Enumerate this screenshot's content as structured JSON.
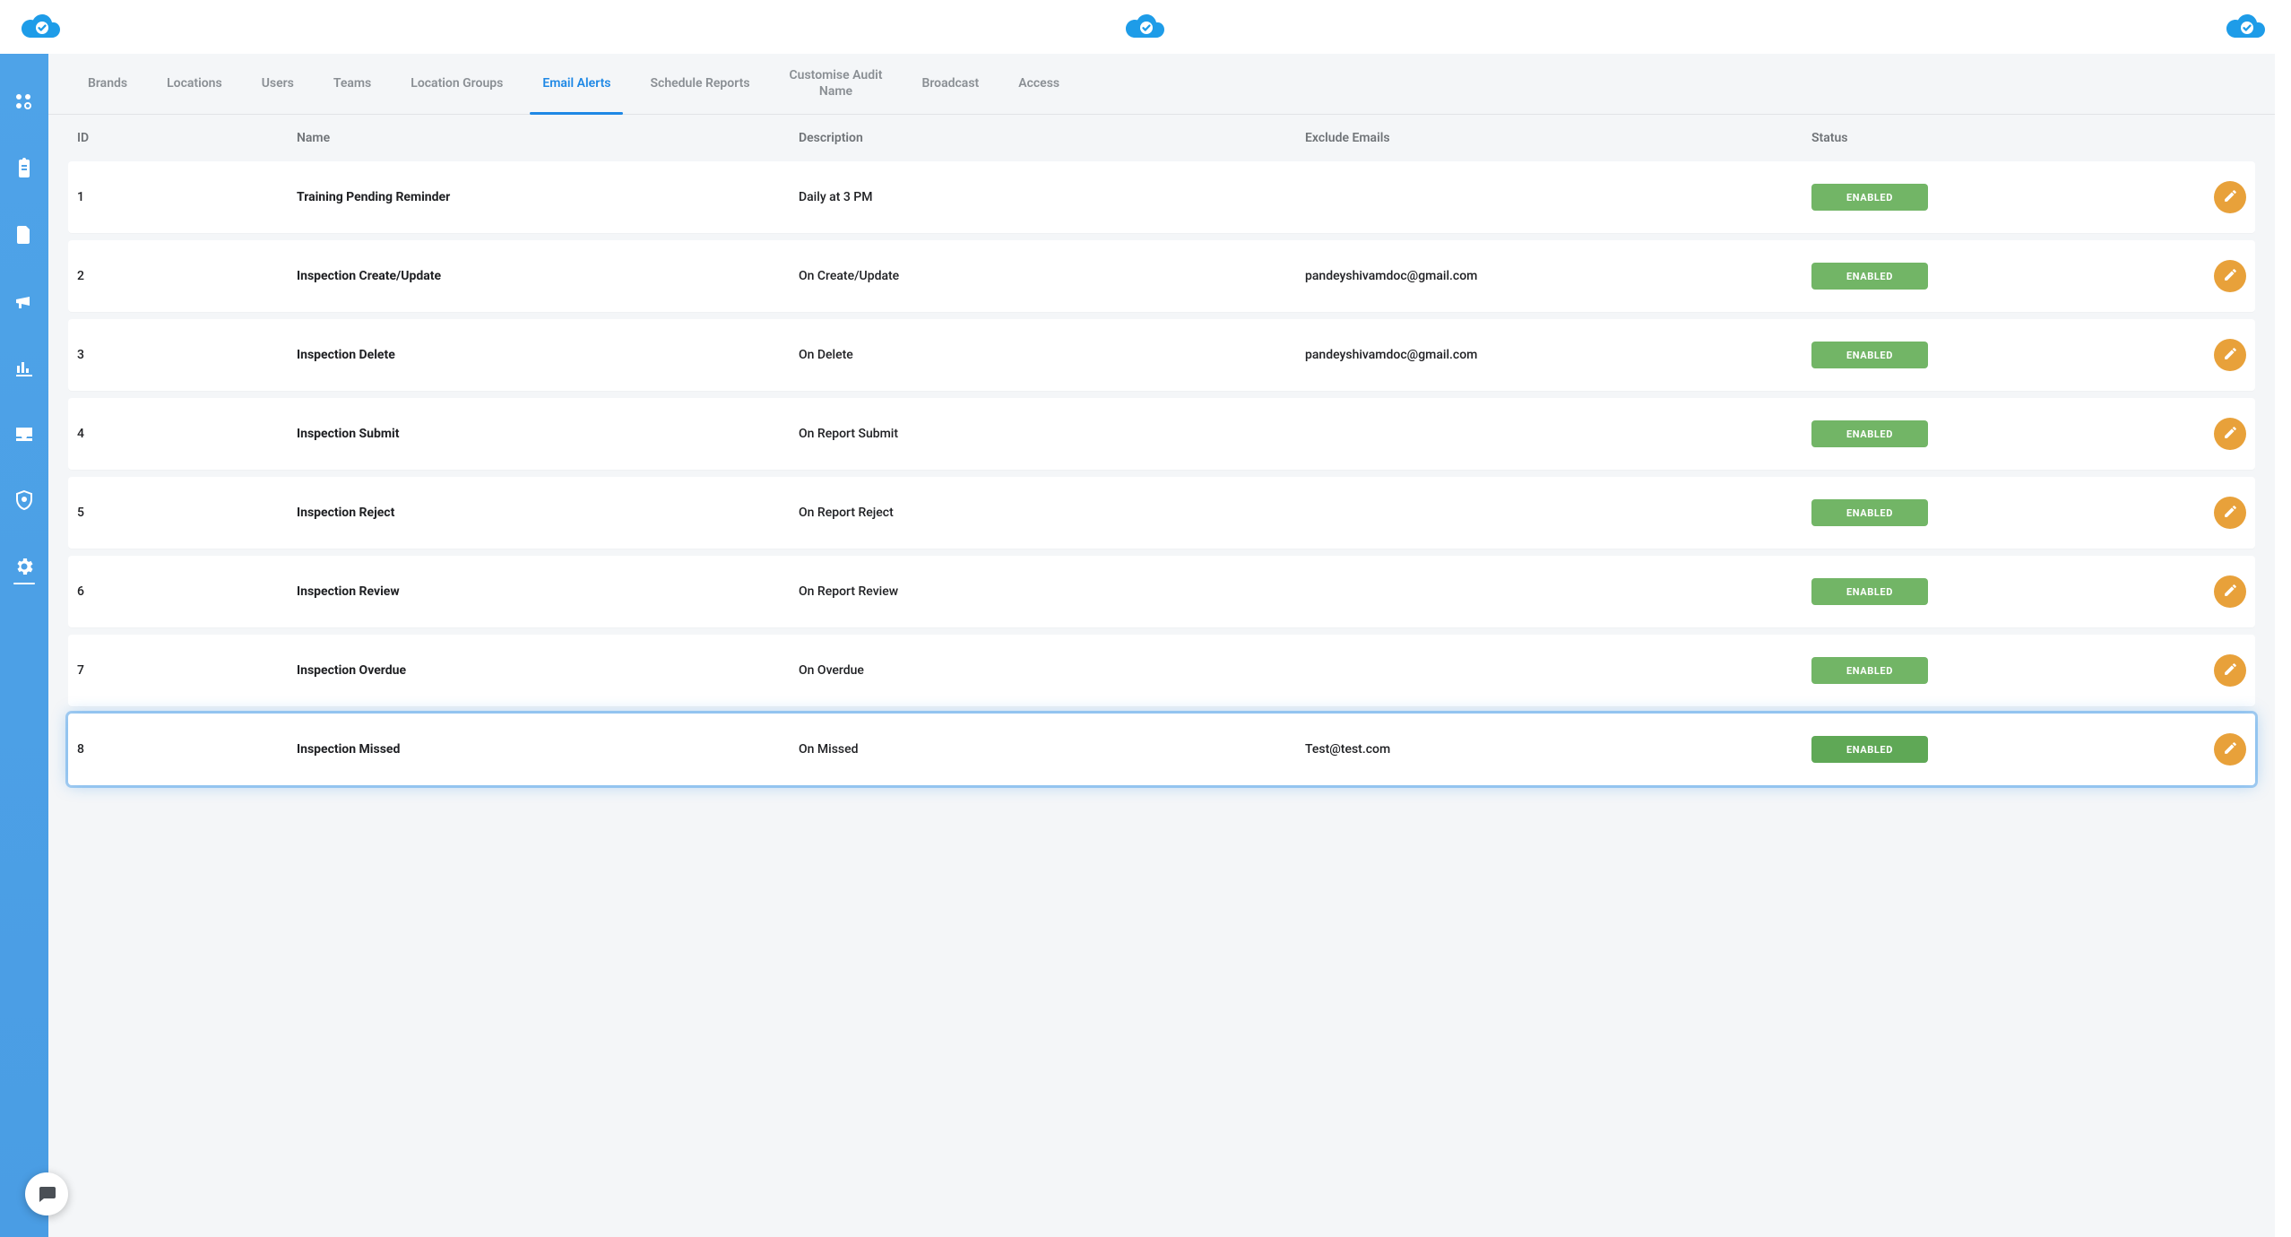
{
  "colors": {
    "accent": "#0E8BDB",
    "sidebar": "#4DA0E6",
    "tab_active": "#1E88E5",
    "badge_green": "#72B566",
    "edit_orange": "#E8A13A"
  },
  "topbar": {
    "logo_name": "cloud-check-icon"
  },
  "sidebar": {
    "items": [
      {
        "icon": "apps-icon"
      },
      {
        "icon": "clipboard-icon"
      },
      {
        "icon": "document-icon"
      },
      {
        "icon": "megaphone-icon"
      },
      {
        "icon": "analytics-icon"
      },
      {
        "icon": "inbox-icon"
      },
      {
        "icon": "shield-icon"
      },
      {
        "icon": "settings-icon",
        "active": true
      }
    ]
  },
  "tabs": [
    {
      "label": "Brands"
    },
    {
      "label": "Locations"
    },
    {
      "label": "Users"
    },
    {
      "label": "Teams"
    },
    {
      "label": "Location Groups"
    },
    {
      "label": "Email Alerts",
      "active": true
    },
    {
      "label": "Schedule Reports"
    },
    {
      "label": "Customise Audit\nName",
      "two_line": true
    },
    {
      "label": "Broadcast"
    },
    {
      "label": "Access"
    }
  ],
  "table": {
    "headers": {
      "id": "ID",
      "name": "Name",
      "description": "Description",
      "exclude": "Exclude Emails",
      "status": "Status"
    },
    "status_enabled_label": "ENABLED",
    "rows": [
      {
        "id": "1",
        "name": "Training Pending Reminder",
        "description": "Daily at 3 PM",
        "exclude": "",
        "status": "ENABLED"
      },
      {
        "id": "2",
        "name": "Inspection Create/Update",
        "description": "On Create/Update",
        "exclude": "pandeyshivamdoc@gmail.com",
        "status": "ENABLED"
      },
      {
        "id": "3",
        "name": "Inspection Delete",
        "description": "On Delete",
        "exclude": "pandeyshivamdoc@gmail.com",
        "status": "ENABLED"
      },
      {
        "id": "4",
        "name": "Inspection Submit",
        "description": "On Report Submit",
        "exclude": "",
        "status": "ENABLED"
      },
      {
        "id": "5",
        "name": "Inspection Reject",
        "description": "On Report Reject",
        "exclude": "",
        "status": "ENABLED"
      },
      {
        "id": "6",
        "name": "Inspection Review",
        "description": "On Report Review",
        "exclude": "",
        "status": "ENABLED"
      },
      {
        "id": "7",
        "name": "Inspection Overdue",
        "description": "On Overdue",
        "exclude": "",
        "status": "ENABLED"
      },
      {
        "id": "8",
        "name": "Inspection Missed",
        "description": "On Missed",
        "exclude": "Test@test.com",
        "status": "ENABLED",
        "highlight": true
      }
    ]
  }
}
